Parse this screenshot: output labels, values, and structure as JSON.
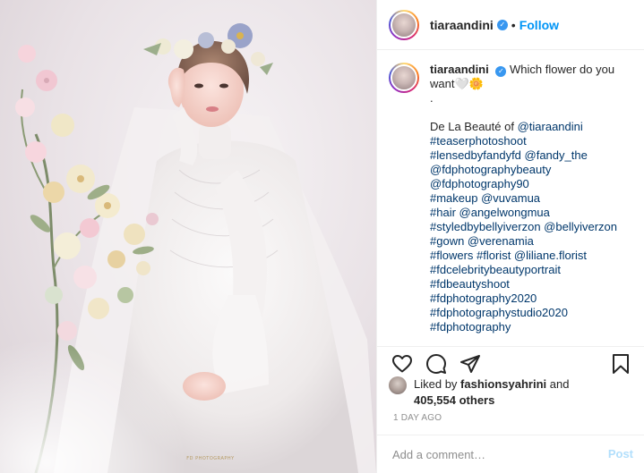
{
  "post": {
    "author": {
      "username": "tiaraandini",
      "verified": true,
      "follow_label": "Follow",
      "separator": "•"
    },
    "caption": {
      "username": "tiaraandini",
      "lines": [
        "Which flower do you",
        "want🤍🌼",
        ".",
        "",
        "De La Beauté of @tiaraandini",
        "#teaserphotoshoot",
        "#lensedbyfandyfd @fandy_the",
        "@fdphotographybeauty",
        "@fdphotography90",
        "#makeup @vuvamua",
        "#hair @angelwongmua",
        "#styledbybellyiverzon @bellyiverzon",
        "#gown @verenamia",
        "#flowers #florist @liliane.florist",
        "#fdcelebritybeautyportrait",
        "#fdbeautyshoot",
        "#fdphotography2020",
        "#fdphotographystudio2020",
        "#fdphotography"
      ]
    },
    "likes": {
      "prefix": "Liked by",
      "liker": "fashionsyahrini",
      "joiner": "and",
      "count_text": "405,554 others"
    },
    "timestamp": "1 DAY AGO",
    "comment": {
      "placeholder": "Add a comment…",
      "post_label": "Post"
    },
    "icons": {
      "like": "heart-icon",
      "comment": "comment-icon",
      "share": "share-icon",
      "save": "bookmark-icon"
    },
    "colors": {
      "accent": "#0095f6",
      "verified": "#3897f0",
      "post_disabled": "#b2dffc",
      "muted": "#8e8e8e"
    },
    "photo": {
      "watermark": "FD PHOTOGRAPHY"
    }
  }
}
